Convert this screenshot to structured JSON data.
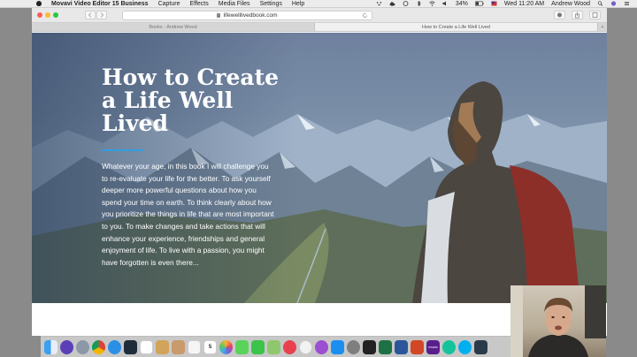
{
  "menubar": {
    "app_name": "Movavi Video Editor 15 Business",
    "items": [
      "Capture",
      "Effects",
      "Media Files",
      "Settings",
      "Help"
    ],
    "battery": "34%",
    "clock": "Wed 11:20 AM",
    "user": "Andrew Wood"
  },
  "browser": {
    "url": "lifewelllivedbook.com",
    "tabs": [
      {
        "label": "Books - Andrew Wood"
      },
      {
        "label": "How to Create a Life Well Lived"
      }
    ],
    "new_tab": "+"
  },
  "hero": {
    "title": "How to Create a Life Well Lived",
    "body": "Whatever your age, in this book I will challenge you to re-evaluate your life for the better. To ask yourself deeper more powerful questions about how you spend your time on earth. To think clearly about how you prioritize the things in life that are most important to you. To make changes and take actions that will enhance your experience, friendships and general enjoyment of life. To live with a passion, you might have forgotten is even there...",
    "accent_color": "#2f9fe0"
  },
  "dock": {
    "icons": [
      "finder-icon",
      "siri-icon",
      "launchpad-icon",
      "chrome-icon",
      "safari-icon",
      "screen-icon",
      "calendar-icon",
      "notes-icon",
      "contacts-icon",
      "reminders-icon",
      "calendar-date-icon",
      "photos-icon",
      "messages-icon",
      "facetime-icon",
      "maps-icon",
      "news-icon",
      "music-icon",
      "podcasts-icon",
      "app-store-icon",
      "preferences-icon",
      "terminal-icon",
      "excel-icon",
      "word-icon",
      "powerpoint-icon",
      "adobe-icon",
      "grammarly-icon",
      "skype-icon",
      "movavi-icon"
    ],
    "calendar_day": "5",
    "adobe_label": "music"
  }
}
